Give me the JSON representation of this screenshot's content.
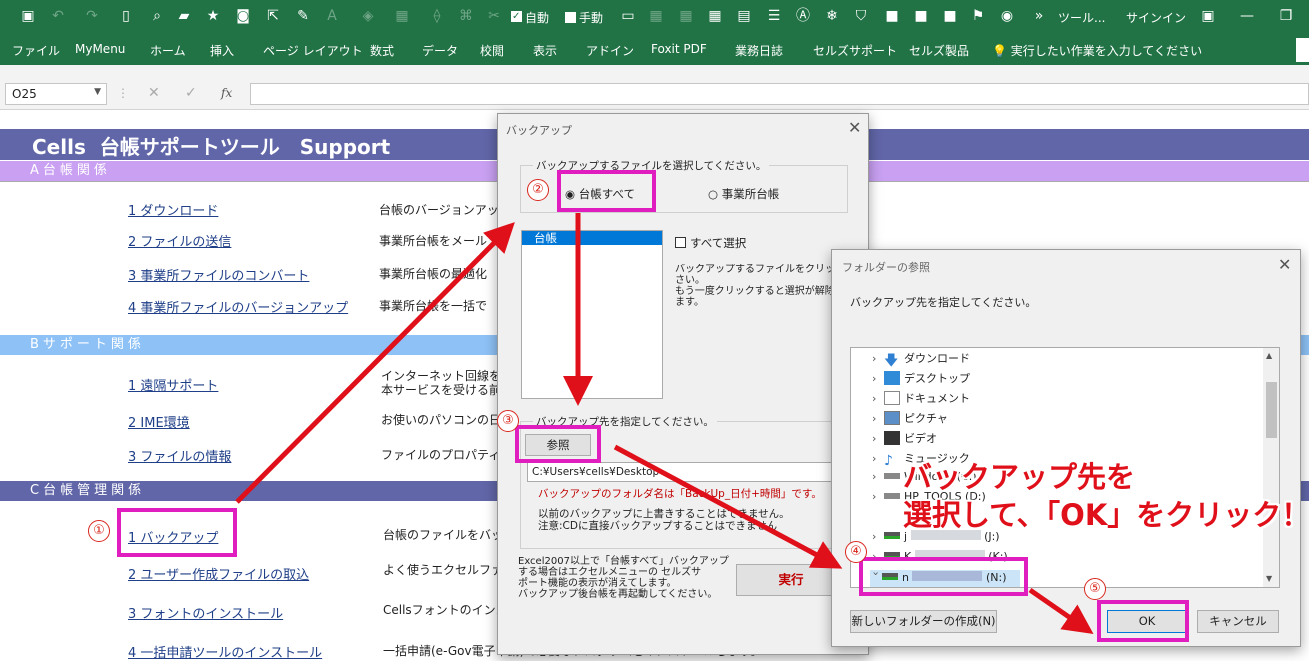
{
  "qat": {
    "check_auto_label": "自動",
    "check_manual_label": "手動",
    "tools_label": "ツール...",
    "signin_label": "サインイン"
  },
  "ribbon": {
    "tabs": [
      "ファイル",
      "MyMenu",
      "ホーム",
      "挿入",
      "ページ レイアウト",
      "数式",
      "データ",
      "校閲",
      "表示",
      "アドイン",
      "Foxit PDF",
      "業務日誌",
      "セルズサポート",
      "セルズ製品"
    ],
    "tell_me": "実行したい作業を入力してください"
  },
  "formula_bar": {
    "name_box": "O25",
    "fx_label": "fx",
    "value": ""
  },
  "sheet": {
    "title": "Cells  台帳サポートツール　Support",
    "section_a": "A台帳関係",
    "section_b": "Bサポート関係",
    "section_c": "C台帳管理関係",
    "a_items": [
      {
        "label": "1  ダウンロード",
        "desc": "台帳のバージョンアッ"
      },
      {
        "label": "2  ファイルの送信",
        "desc": "事業所台帳をメール"
      },
      {
        "label": "3  事業所ファイルのコンバート",
        "desc": "事業所台帳の最適化"
      },
      {
        "label": "4  事業所ファイルのバージョンアップ",
        "desc": "事業所台帳を一括で"
      }
    ],
    "b_items": [
      {
        "label": "1  遠隔サポート",
        "desc": "インターネット回線を利",
        "desc2": "本サービスを受ける前"
      },
      {
        "label": "2  IME環境",
        "desc": "お使いのパソコンの日"
      },
      {
        "label": "3  ファイルの情報",
        "desc": "ファイルのプロパティ"
      }
    ],
    "c_items": [
      {
        "label": "1  バックアップ",
        "desc": "台帳のファイルをバッ"
      },
      {
        "label": "2  ユーザー作成ファイルの取込",
        "desc": "よく使うエクセルファイ"
      },
      {
        "label": "3  フォントのインストール",
        "desc": "Cellsフォントのインストールします。雇用保険資格取得届等のOCR用紙への印刷"
      },
      {
        "label": "4  一括申請ツールのインストール",
        "desc": "一括申請(e-Gov電子申請)で必要なプログラムをインストールします。"
      }
    ]
  },
  "backup_dialog": {
    "title": "バックアップ",
    "group1_label": "バックアップするファイルを選択してください。",
    "radio_all": "台帳すべて",
    "radio_office": "事業所台帳",
    "list_selected": "台帳",
    "select_all_label": "すべて選択",
    "help_text_1": "バックアップするファイルをクリックして",
    "help_text_2": "さい。",
    "help_text_3": "もう一度クリックすると選択が解除さ",
    "help_text_4": "ます。",
    "group2_label": "バックアップ先を指定してください。",
    "browse_button": "参照",
    "path_value": "C:¥Users¥cells¥Desktop",
    "note_red": "バックアップのフォルダ名は「BackUp_日付+時間」です。",
    "note_1": "以前のバックアップに上書きすることはできません。",
    "note_2": "注意:CDに直接バックアップすることはできません",
    "note_excel_1": "Excel2007以上で「台帳すべて」バックアップ",
    "note_excel_2": "する場合はエクセルメニューの セルズサ",
    "note_excel_3": "ポート機能の表示が消えてします。",
    "note_excel_4": "バックアップ後台帳を再起動してください。",
    "run_button": "実行"
  },
  "folder_dialog": {
    "title": "フォルダーの参照",
    "prompt": "バックアップ先を指定してください。",
    "tree": [
      {
        "label": "ダウンロード",
        "icon": "download-icon"
      },
      {
        "label": "デスクトップ",
        "icon": "desktop-icon"
      },
      {
        "label": "ドキュメント",
        "icon": "document-icon"
      },
      {
        "label": "ピクチャ",
        "icon": "picture-icon"
      },
      {
        "label": "ビデオ",
        "icon": "video-icon"
      },
      {
        "label": "ミュージック",
        "icon": "music-icon"
      },
      {
        "label": "Windows (C:)",
        "icon": "drive-icon"
      },
      {
        "label": "HP_TOOLS (D:)",
        "icon": "drive-icon"
      },
      {
        "label": "j",
        "drive": "(J:)",
        "icon": "network-drive-icon"
      },
      {
        "label": "K",
        "drive": "(K:)",
        "icon": "network-drive-icon"
      },
      {
        "label": "n",
        "drive": "(N:)",
        "icon": "network-drive-icon"
      }
    ],
    "new_folder_button": "新しいフォルダーの作成(N)",
    "ok_button": "OK",
    "cancel_button": "キャンセル"
  },
  "annotations": {
    "step1": "①",
    "step2": "②",
    "step3": "③",
    "step4": "④",
    "step5": "⑤",
    "callout_line1": "バックアップ先を",
    "callout_line2": "選択して、「OK」をクリック！"
  },
  "colors": {
    "excel_green": "#217346",
    "highlight_magenta": "#e01dbf",
    "arrow_red": "#e0101a",
    "title_band": "#6166a8",
    "section_a_band": "#c9a0f2",
    "section_b_band": "#8ec2f7"
  }
}
